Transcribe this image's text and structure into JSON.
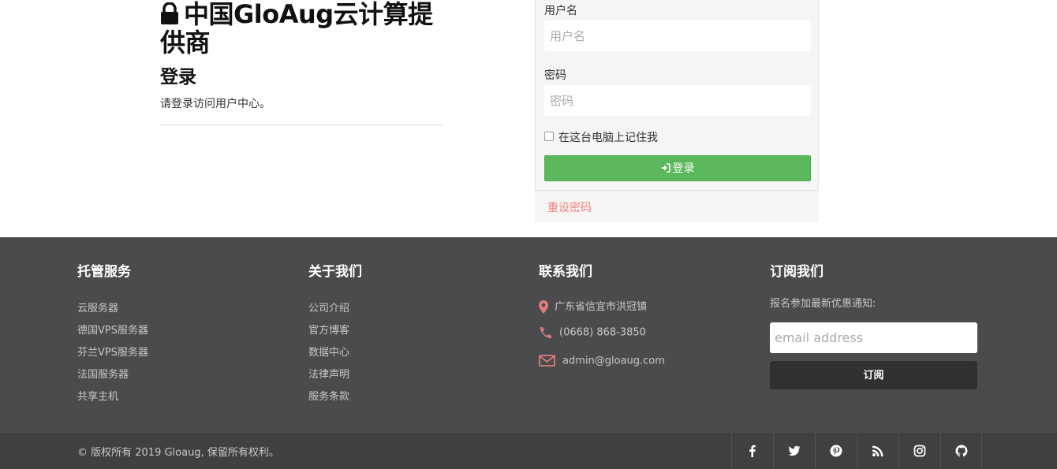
{
  "header": {
    "site_title": "中国GloAug云计算提供商",
    "login_heading": "登录",
    "login_desc": "请登录访问用户中心。"
  },
  "form": {
    "username_label": "用户名",
    "username_placeholder": "用户名",
    "password_label": "密码",
    "password_placeholder": "密码",
    "remember_label": "在这台电脑上记住我",
    "login_button": "登录",
    "reset_link": "重设密码"
  },
  "footer": {
    "hosting": {
      "title": "托管服务",
      "items": [
        "云服务器",
        "德国VPS服务器",
        "芬兰VPS服务器",
        "法国服务器",
        "共享主机"
      ]
    },
    "about": {
      "title": "关于我们",
      "items": [
        "公司介绍",
        "官方博客",
        "数据中心",
        "法律声明",
        "服务条款"
      ]
    },
    "contact": {
      "title": "联系我们",
      "address": "广东省信宜市洪冠镇",
      "phone": "(0668) 868-3850",
      "email": "admin@gloaug.com"
    },
    "subscribe": {
      "title": "订阅我们",
      "desc": "报名参加最新优惠通知:",
      "email_placeholder": "email address",
      "button": "订阅"
    },
    "copyright": "© 版权所有 2019 Gloaug, 保留所有权利。",
    "social": [
      "facebook-icon",
      "twitter-icon",
      "pinterest-icon",
      "rss-icon",
      "instagram-icon",
      "github-icon"
    ]
  },
  "colors": {
    "accent_green": "#5cb85c",
    "link_pink": "#f0837e",
    "footer_bg": "#4a4b4d",
    "bottom_bar_bg": "#3f4042",
    "contact_icon": "#e07b7b"
  }
}
